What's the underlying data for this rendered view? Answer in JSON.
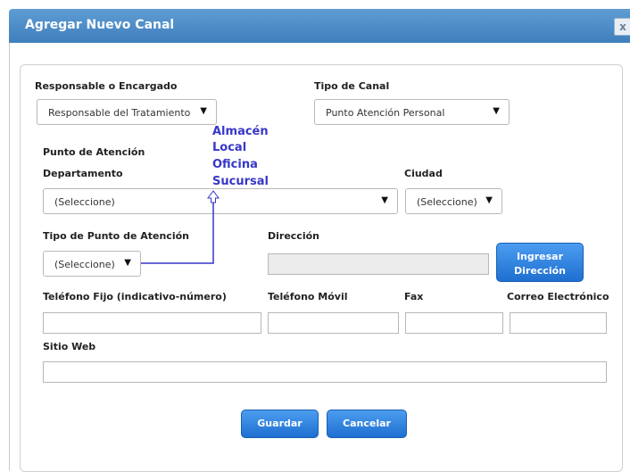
{
  "dialog": {
    "title": "Agregar Nuevo Canal",
    "close_label": "x"
  },
  "form": {
    "responsable": {
      "label": "Responsable o Encargado",
      "value": "Responsable del Tratamiento"
    },
    "tipo_canal": {
      "label": "Tipo de Canal",
      "value": "Punto Atención Personal"
    },
    "punto_atencion_heading": "Punto de Atención",
    "departamento": {
      "label": "Departamento",
      "value": "(Seleccione)"
    },
    "ciudad": {
      "label": "Ciudad",
      "value": "(Seleccione)"
    },
    "tipo_punto": {
      "label": "Tipo de Punto de Atención",
      "value": "(Seleccione)"
    },
    "direccion": {
      "label": "Dirección",
      "value": ""
    },
    "ingresar_direccion_line1": "Ingresar",
    "ingresar_direccion_line2": "Dirección",
    "telefono_fijo": {
      "label": "Teléfono Fijo (indicativo-número)",
      "value": ""
    },
    "telefono_movil": {
      "label": "Teléfono Móvil",
      "value": ""
    },
    "fax": {
      "label": "Fax",
      "value": ""
    },
    "correo": {
      "label": "Correo Electrónico",
      "value": ""
    },
    "sitio_web": {
      "label": "Sitio Web",
      "value": ""
    },
    "guardar": "Guardar",
    "cancelar": "Cancelar"
  },
  "annotation": {
    "options": [
      "Almacén",
      "Local",
      "Oficina",
      "Sucursal"
    ],
    "color": "#3737c8"
  }
}
